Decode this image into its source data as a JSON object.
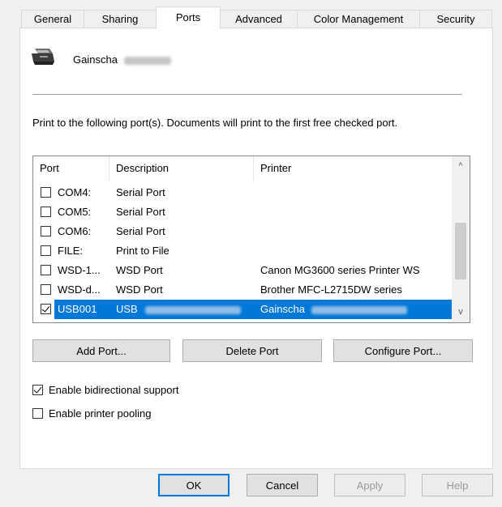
{
  "tabs": [
    {
      "label": "General"
    },
    {
      "label": "Sharing"
    },
    {
      "label": "Ports"
    },
    {
      "label": "Advanced"
    },
    {
      "label": "Color Management"
    },
    {
      "label": "Security"
    }
  ],
  "active_tab": "Ports",
  "printer": {
    "name": "Gainscha"
  },
  "description": "Print to the following port(s). Documents will print to the first free checked port.",
  "ports_table": {
    "columns": [
      "Port",
      "Description",
      "Printer"
    ],
    "rows": [
      {
        "checked": false,
        "port": "COM4:",
        "description": "Serial Port",
        "printer": ""
      },
      {
        "checked": false,
        "port": "COM5:",
        "description": "Serial Port",
        "printer": ""
      },
      {
        "checked": false,
        "port": "COM6:",
        "description": "Serial Port",
        "printer": ""
      },
      {
        "checked": false,
        "port": "FILE:",
        "description": "Print to File",
        "printer": ""
      },
      {
        "checked": false,
        "port": "WSD-1...",
        "description": "WSD Port",
        "printer": "Canon MG3600 series Printer WS"
      },
      {
        "checked": false,
        "port": "WSD-d...",
        "description": "WSD Port",
        "printer": "Brother MFC-L2715DW series"
      },
      {
        "checked": true,
        "port": "USB001",
        "description": "USB",
        "printer": "Gainscha",
        "selected": true
      }
    ],
    "scroll_up_glyph": "^",
    "scroll_down_glyph": "v"
  },
  "port_buttons": {
    "add": "Add Port...",
    "delete": "Delete Port",
    "configure": "Configure Port..."
  },
  "options": {
    "bidirectional": {
      "label": "Enable bidirectional support",
      "checked": true
    },
    "pooling": {
      "label": "Enable printer pooling",
      "checked": false
    }
  },
  "dialog_buttons": {
    "ok": "OK",
    "cancel": "Cancel",
    "apply": "Apply",
    "help": "Help"
  },
  "colors": {
    "selection": "#0078d7",
    "panel_border": "#d9d9d9"
  }
}
